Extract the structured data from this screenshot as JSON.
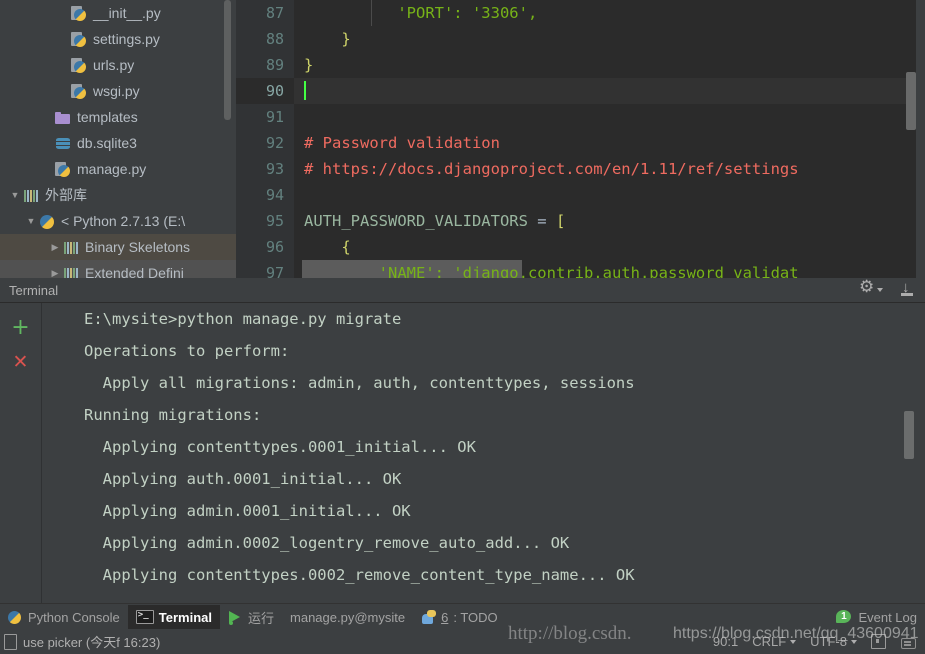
{
  "project_tree": {
    "items": [
      {
        "label": "__init__.py",
        "icon": "python-file-icon",
        "indent": 56,
        "twisty": "",
        "state": ""
      },
      {
        "label": "settings.py",
        "icon": "python-file-icon",
        "indent": 56,
        "twisty": "",
        "state": ""
      },
      {
        "label": "urls.py",
        "icon": "python-file-icon",
        "indent": 56,
        "twisty": "",
        "state": ""
      },
      {
        "label": "wsgi.py",
        "icon": "python-file-icon",
        "indent": 56,
        "twisty": "",
        "state": ""
      },
      {
        "label": "templates",
        "icon": "folder-icon",
        "indent": 40,
        "twisty": "",
        "state": ""
      },
      {
        "label": "db.sqlite3",
        "icon": "database-icon",
        "indent": 40,
        "twisty": "",
        "state": ""
      },
      {
        "label": "manage.py",
        "icon": "python-file-icon",
        "indent": 40,
        "twisty": "",
        "state": ""
      },
      {
        "label": "外部库",
        "icon": "library-icon",
        "indent": 8,
        "twisty": "▼",
        "state": ""
      },
      {
        "label": "< Python 2.7.13 (E:\\",
        "icon": "python-interpreter-icon",
        "indent": 24,
        "twisty": "▼",
        "state": ""
      },
      {
        "label": "Binary Skeletons",
        "icon": "library-icon",
        "indent": 48,
        "twisty": "▶",
        "state": "sel-a"
      },
      {
        "label": "Extended Defini",
        "icon": "library-icon",
        "indent": 48,
        "twisty": "▶",
        "state": "sel-b"
      }
    ]
  },
  "editor": {
    "first_line": 87,
    "current_line": 90,
    "lines": [
      {
        "n": 87,
        "tokens": [
          {
            "t": "          'PORT': '3306',",
            "c": "tok-gstr"
          }
        ]
      },
      {
        "n": 88,
        "tokens": [
          {
            "t": "    }",
            "c": "tok-brace"
          }
        ]
      },
      {
        "n": 89,
        "tokens": [
          {
            "t": "}",
            "c": "tok-brace"
          }
        ]
      },
      {
        "n": 90,
        "tokens": [],
        "caret": true
      },
      {
        "n": 91,
        "tokens": []
      },
      {
        "n": 92,
        "tokens": [
          {
            "t": "# Password validation",
            "c": "tok-cm"
          }
        ]
      },
      {
        "n": 93,
        "tokens": [
          {
            "t": "# https://docs.djangoproject.com/en/1.11/ref/settings",
            "c": "tok-cm"
          }
        ]
      },
      {
        "n": 94,
        "tokens": []
      },
      {
        "n": 95,
        "tokens": [
          {
            "t": "AUTH_PASSWORD_VALIDATORS",
            "c": "tok-const"
          },
          {
            "t": " = ",
            "c": "tok-op"
          },
          {
            "t": "[",
            "c": "tok-brace"
          }
        ]
      },
      {
        "n": 96,
        "tokens": [
          {
            "t": "    {",
            "c": "tok-brace"
          }
        ]
      },
      {
        "n": 97,
        "tokens": [
          {
            "t": "        'NAME': 'django.contrib.auth.password_validat",
            "c": "tok-gstr"
          }
        ]
      }
    ]
  },
  "terminal": {
    "title": "Terminal",
    "add_button": "+",
    "close_button": "✕",
    "settings_icon": "gear-icon",
    "hide_icon": "hide-panel-icon",
    "lines": [
      "E:\\mysite>python manage.py migrate",
      "Operations to perform:",
      "  Apply all migrations: admin, auth, contenttypes, sessions",
      "Running migrations:",
      "  Applying contenttypes.0001_initial... OK",
      "  Applying auth.0001_initial... OK",
      "  Applying admin.0001_initial... OK",
      "  Applying admin.0002_logentry_remove_auto_add... OK",
      "  Applying contenttypes.0002_remove_content_type_name... OK"
    ]
  },
  "tool_tabs": [
    {
      "label": "Python Console",
      "icon": "python-console-icon",
      "active": false,
      "prefix": ""
    },
    {
      "label": "Terminal",
      "icon": "terminal-icon",
      "active": true,
      "prefix": ""
    },
    {
      "label": "运行",
      "icon": "run-icon",
      "active": false,
      "prefix": ""
    },
    {
      "label": "manage.py@mysite",
      "icon": "",
      "active": false,
      "prefix": ""
    },
    {
      "label": ": TODO",
      "icon": "todo-icon",
      "active": false,
      "prefix": "6"
    }
  ],
  "event_log": {
    "label": "Event Log",
    "badge": "1",
    "icon": "event-log-icon"
  },
  "status_bar": {
    "left_text": "use picker (今天f 16:23)",
    "left_icon": "document-icon",
    "caret_position": "90:1",
    "line_separator": "CRLF",
    "encoding": "UTF-8",
    "lock_icon": "lock-icon",
    "bot_icon": "robot-icon"
  },
  "watermarks": [
    {
      "text": "http://blog.csdn.",
      "style": "serif"
    },
    {
      "text": "https://blog.csdn.net/qq_43600941",
      "style": "sans"
    }
  ],
  "colors": {
    "ide_background": "#3c3f41",
    "editor_background": "#2b2b2b",
    "gutter_background": "#313335",
    "comment": "#ef6b60",
    "string": "#77b318",
    "caret": "#44ff44",
    "terminal_text": "#c2d1c4",
    "accent_green": "#59b459",
    "accent_red": "#d9534f"
  }
}
